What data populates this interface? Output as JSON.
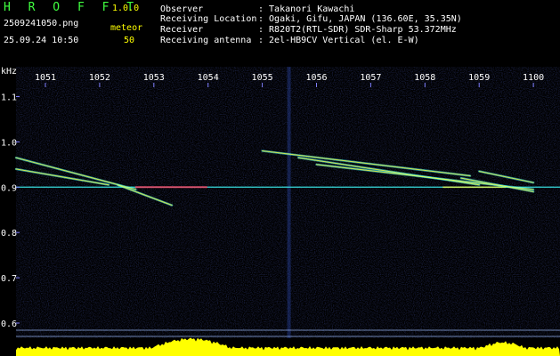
{
  "app": {
    "title": "H R O F F T",
    "version": "1.0.0"
  },
  "file": {
    "name": "2509241050.png",
    "datetime": "25.09.24 10:50"
  },
  "meteor": {
    "label": "meteor",
    "count": "50"
  },
  "station": {
    "rows": [
      {
        "label": "Observer",
        "value": ": Takanori Kawachi"
      },
      {
        "label": "Receiving Location",
        "value": ": Ogaki, Gifu, JAPAN (136.60E, 35.35N)"
      },
      {
        "label": "Receiver",
        "value": ": R820T2(RTL-SDR) SDR-Sharp 53.372MHz"
      },
      {
        "label": "Receiving antenna",
        "value": ": 2el-HB9CV Vertical (el. E-W)"
      }
    ]
  },
  "colors": {
    "title": "#40ff40",
    "header_text": "#ffffff",
    "meta_text": "#ffff00",
    "axis_text": "#ffffff",
    "background": "#000000",
    "noise": "#1a2a90",
    "echo_core": "#ff4060",
    "echo_mid": "#ffff40",
    "echo_edge": "#40ffff",
    "baseline": "#ffff00"
  },
  "chart_data": {
    "type": "heatmap",
    "xlabel": "",
    "ylabel": "kHz",
    "x_ticks": [
      "1051",
      "1052",
      "1053",
      "1054",
      "1055",
      "1056",
      "1057",
      "1058",
      "1059",
      "1100"
    ],
    "y_ticks": [
      "1.1",
      "1.0",
      "0.9",
      "0.8",
      "0.7",
      "0.6"
    ],
    "ylim": [
      0.6,
      1.15
    ],
    "carrier_khz": 0.9,
    "echoes": [
      {
        "t_start": "10:50:00",
        "t_end": "10:52:40",
        "f_start": 0.965,
        "f_end": 0.895
      },
      {
        "t_start": "10:50:00",
        "t_end": "10:52:10",
        "f_start": 0.94,
        "f_end": 0.905
      },
      {
        "t_start": "10:52:20",
        "t_end": "10:53:20",
        "f_start": 0.905,
        "f_end": 0.86
      },
      {
        "t_start": "10:55:00",
        "t_end": "10:58:50",
        "f_start": 0.98,
        "f_end": 0.925
      },
      {
        "t_start": "10:55:40",
        "t_end": "10:59:00",
        "f_start": 0.965,
        "f_end": 0.905
      },
      {
        "t_start": "10:56:00",
        "t_end": "11:00:00",
        "f_start": 0.95,
        "f_end": 0.895
      },
      {
        "t_start": "10:58:40",
        "t_end": "11:00:00",
        "f_start": 0.92,
        "f_end": 0.89
      },
      {
        "t_start": "10:59:00",
        "t_end": "11:00:00",
        "f_start": 0.935,
        "f_end": 0.91
      }
    ]
  }
}
